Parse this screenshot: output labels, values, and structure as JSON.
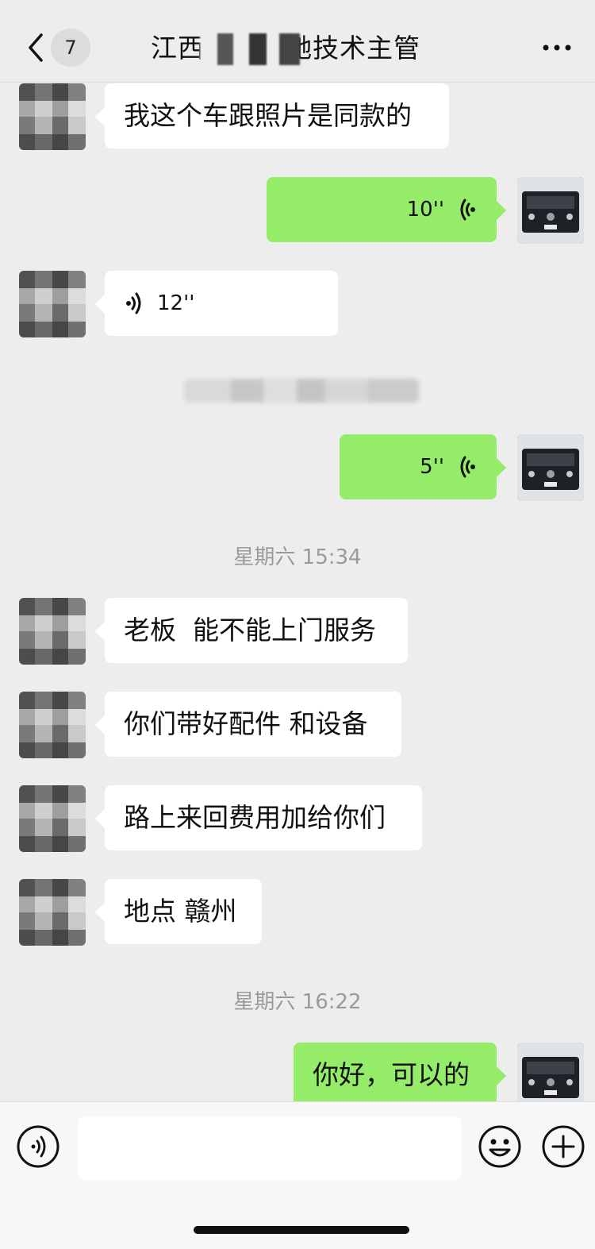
{
  "header": {
    "unread_count": "7",
    "title": "江西　　　驰技术主管"
  },
  "messages": {
    "m1_text": "我这个车跟照片是同款的",
    "m2_voice": "10''",
    "m3_voice": "12''",
    "m5_voice": "5''",
    "ts2": "星期六 15:34",
    "m6_text": "老板  能不能上门服务",
    "m7_text": "你们带好配件 和设备",
    "m8_text": "路上来回费用加给你们",
    "m9_text": "地点 赣州",
    "ts3": "星期六 16:22",
    "m10_text": "你好，可以的"
  },
  "colors": {
    "self_bubble": "#95ec69",
    "other_bubble": "#ffffff",
    "background": "#ededed"
  },
  "icons": {
    "back": "chevron-left-icon",
    "more": "more-dots-icon",
    "voice": "voice-wave-icon",
    "emoji": "emoji-smile-icon",
    "plus": "plus-circle-icon"
  }
}
